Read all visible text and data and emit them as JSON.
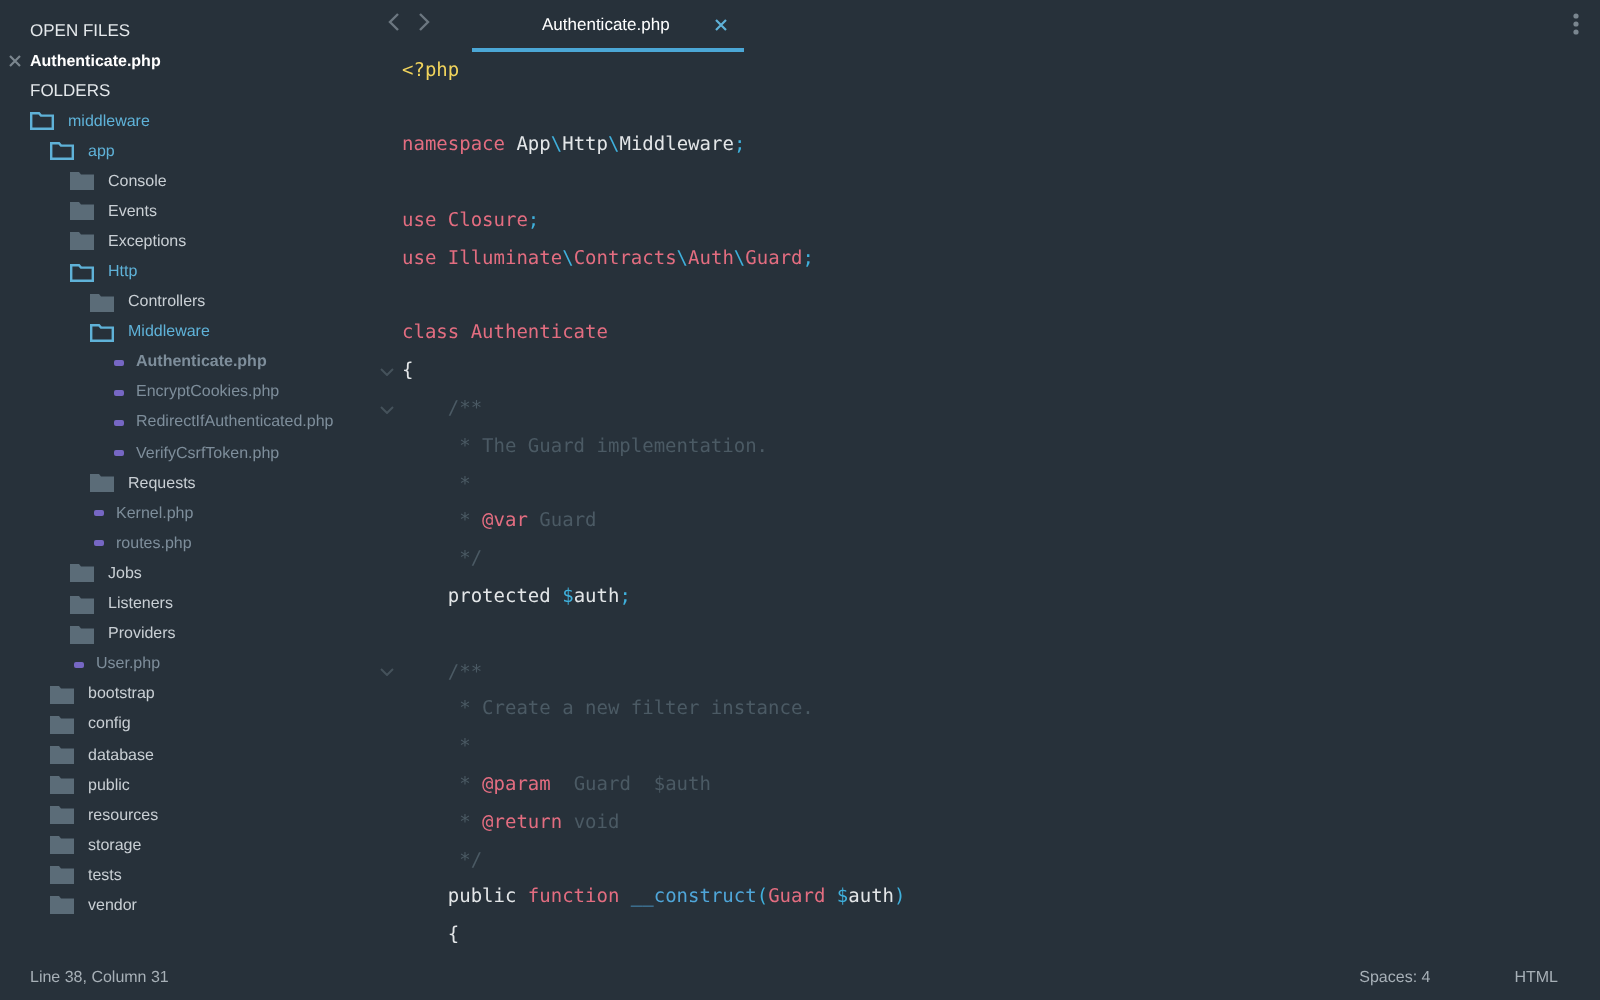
{
  "sidebar": {
    "open_files_heading": "OPEN FILES",
    "open_files": [
      {
        "name": "Authenticate.php",
        "selected": true
      }
    ],
    "folders_heading": "FOLDERS",
    "tree": [
      {
        "name": "middleware",
        "kind": "folder",
        "expanded": true,
        "selected": false,
        "children": [
          {
            "name": "app",
            "kind": "folder",
            "expanded": true,
            "selected": false,
            "children": [
              {
                "name": "Console",
                "kind": "folder",
                "expanded": false,
                "selected": false
              },
              {
                "name": "Events",
                "kind": "folder",
                "expanded": false,
                "selected": false
              },
              {
                "name": "Exceptions",
                "kind": "folder",
                "expanded": false,
                "selected": false
              },
              {
                "name": "Http",
                "kind": "folder",
                "expanded": true,
                "selected": false,
                "children": [
                  {
                    "name": "Controllers",
                    "kind": "folder",
                    "expanded": false,
                    "selected": false
                  },
                  {
                    "name": "Middleware",
                    "kind": "folder",
                    "expanded": true,
                    "selected": false,
                    "children": [
                      {
                        "name": "Authenticate.php",
                        "kind": "file",
                        "selected": true
                      },
                      {
                        "name": "EncryptCookies.php",
                        "kind": "file",
                        "selected": false
                      },
                      {
                        "name": "RedirectIfAuthenticated.php",
                        "kind": "file",
                        "selected": false
                      },
                      {
                        "name": "VerifyCsrfToken.php",
                        "kind": "file",
                        "selected": false
                      }
                    ]
                  },
                  {
                    "name": "Requests",
                    "kind": "folder",
                    "expanded": false,
                    "selected": false
                  },
                  {
                    "name": "Kernel.php",
                    "kind": "file",
                    "selected": false
                  },
                  {
                    "name": "routes.php",
                    "kind": "file",
                    "selected": false
                  }
                ]
              },
              {
                "name": "Jobs",
                "kind": "folder",
                "expanded": false,
                "selected": false
              },
              {
                "name": "Listeners",
                "kind": "folder",
                "expanded": false,
                "selected": false
              },
              {
                "name": "Providers",
                "kind": "folder",
                "expanded": false,
                "selected": false
              },
              {
                "name": "User.php",
                "kind": "file",
                "selected": false
              }
            ]
          },
          {
            "name": "bootstrap",
            "kind": "folder",
            "expanded": false,
            "selected": false
          },
          {
            "name": "config",
            "kind": "folder",
            "expanded": false,
            "selected": false
          },
          {
            "name": "database",
            "kind": "folder",
            "expanded": false,
            "selected": false
          },
          {
            "name": "public",
            "kind": "folder",
            "expanded": false,
            "selected": false
          },
          {
            "name": "resources",
            "kind": "folder",
            "expanded": false,
            "selected": false
          },
          {
            "name": "storage",
            "kind": "folder",
            "expanded": false,
            "selected": false
          },
          {
            "name": "tests",
            "kind": "folder",
            "expanded": false,
            "selected": false
          },
          {
            "name": "vendor",
            "kind": "folder",
            "expanded": false,
            "selected": false
          }
        ]
      }
    ]
  },
  "tabs": [
    {
      "label": "Authenticate.php",
      "selected": true
    }
  ],
  "code": [
    {
      "fold": false,
      "tokens": [
        {
          "kind": "tag",
          "text": "<?php"
        }
      ]
    },
    {
      "fold": false
    },
    {
      "fold": false,
      "tokens": [
        {
          "kind": "keyword",
          "text": "namespace "
        },
        {
          "kind": "plain",
          "text": "App"
        },
        {
          "kind": "punct",
          "text": "\\"
        },
        {
          "kind": "plain",
          "text": "Http"
        },
        {
          "kind": "punct",
          "text": "\\"
        },
        {
          "kind": "plain",
          "text": "Middleware"
        },
        {
          "kind": "punct",
          "text": ";"
        }
      ]
    },
    {
      "fold": false
    },
    {
      "fold": false,
      "tokens": [
        {
          "kind": "keyword",
          "text": "use Closure"
        },
        {
          "kind": "punct",
          "text": ";"
        }
      ]
    },
    {
      "fold": false,
      "tokens": [
        {
          "kind": "keyword",
          "text": "use Illuminate"
        },
        {
          "kind": "punct",
          "text": "\\"
        },
        {
          "kind": "keyword",
          "text": "Contracts"
        },
        {
          "kind": "punct",
          "text": "\\"
        },
        {
          "kind": "keyword",
          "text": "Auth"
        },
        {
          "kind": "punct",
          "text": "\\"
        },
        {
          "kind": "keyword",
          "text": "Guard"
        },
        {
          "kind": "punct",
          "text": ";"
        }
      ]
    },
    {
      "fold": false
    },
    {
      "fold": false,
      "tokens": [
        {
          "kind": "keyword",
          "text": "class Authenticate"
        }
      ]
    },
    {
      "fold": true,
      "tokens": [
        {
          "kind": "plain",
          "text": "{"
        }
      ]
    },
    {
      "fold": true,
      "tokens": [
        {
          "kind": "comment",
          "text": "    /**"
        }
      ]
    },
    {
      "fold": false,
      "tokens": [
        {
          "kind": "comment",
          "text": "     * The Guard implementation."
        }
      ]
    },
    {
      "fold": false,
      "tokens": [
        {
          "kind": "comment",
          "text": "     *"
        }
      ]
    },
    {
      "fold": false,
      "tokens": [
        {
          "kind": "comment",
          "text": "     * "
        },
        {
          "kind": "doctag",
          "text": "@var"
        },
        {
          "kind": "comment",
          "text": " Guard"
        }
      ]
    },
    {
      "fold": false,
      "tokens": [
        {
          "kind": "comment",
          "text": "     */"
        }
      ]
    },
    {
      "fold": false,
      "tokens": [
        {
          "kind": "plain",
          "text": "    protected "
        },
        {
          "kind": "punct",
          "text": "$"
        },
        {
          "kind": "plain",
          "text": "auth"
        },
        {
          "kind": "punct",
          "text": ";"
        }
      ]
    },
    {
      "fold": false
    },
    {
      "fold": true,
      "tokens": [
        {
          "kind": "comment",
          "text": "    /**"
        }
      ]
    },
    {
      "fold": false,
      "tokens": [
        {
          "kind": "comment",
          "text": "     * Create a new filter instance."
        }
      ]
    },
    {
      "fold": false,
      "tokens": [
        {
          "kind": "comment",
          "text": "     *"
        }
      ]
    },
    {
      "fold": false,
      "tokens": [
        {
          "kind": "comment",
          "text": "     * "
        },
        {
          "kind": "doctag",
          "text": "@param"
        },
        {
          "kind": "comment",
          "text": "  Guard  $auth"
        }
      ]
    },
    {
      "fold": false,
      "tokens": [
        {
          "kind": "comment",
          "text": "     * "
        },
        {
          "kind": "doctag",
          "text": "@return"
        },
        {
          "kind": "comment",
          "text": " void"
        }
      ]
    },
    {
      "fold": false,
      "tokens": [
        {
          "kind": "comment",
          "text": "     */"
        }
      ]
    },
    {
      "fold": false,
      "tokens": [
        {
          "kind": "plain",
          "text": "    public "
        },
        {
          "kind": "keyword",
          "text": "function "
        },
        {
          "kind": "func",
          "text": "__construct"
        },
        {
          "kind": "punct",
          "text": "("
        },
        {
          "kind": "keyword",
          "text": "Guard "
        },
        {
          "kind": "punct",
          "text": "$"
        },
        {
          "kind": "plain",
          "text": "auth"
        },
        {
          "kind": "punct",
          "text": ")"
        }
      ]
    },
    {
      "fold": false,
      "tokens": [
        {
          "kind": "plain",
          "text": "    {"
        }
      ]
    }
  ],
  "status_bar": {
    "position": "Line 38, Column 31",
    "indentation": "Spaces: 4",
    "syntax": "HTML"
  }
}
